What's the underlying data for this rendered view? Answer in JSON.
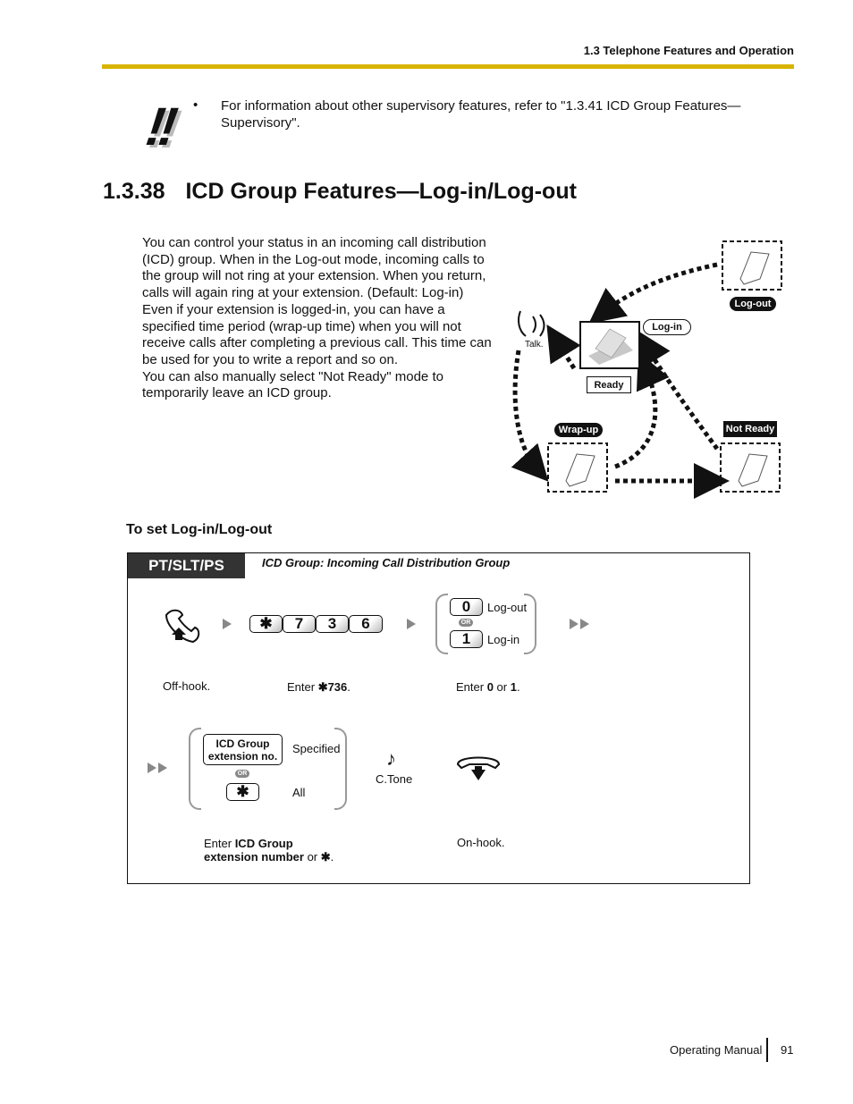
{
  "header": {
    "section_title": "1.3 Telephone Features and Operation"
  },
  "note": {
    "icon": "exclamation-note-icon",
    "bullet": "•",
    "text": "For information about other supervisory features, refer to \"1.3.41 ICD Group Features—Supervisory\"."
  },
  "section": {
    "number": "1.3.38",
    "title": "ICD Group Features—Log-in/Log-out"
  },
  "body_lines": [
    "You can control your status in an incoming call distribution",
    "(ICD) group. When in the Log-out mode, incoming calls to",
    "the group will not ring at your extension. When you return,",
    "calls will again ring at your extension. (Default: Log-in)",
    "Even if your extension is logged-in, you can have a",
    "specified time period (wrap-up time) when you will not",
    "receive calls after completing a previous call. This time can",
    "be used for you to write a report and so on.",
    "You can also manually select \"Not Ready\" mode to",
    "temporarily leave an ICD group."
  ],
  "diagram": {
    "talk_label": "Talk.",
    "login_label": "Log-in",
    "logout_label": "Log-out",
    "ready_label": "Ready",
    "wrapup_label": "Wrap-up",
    "notready_label": "Not Ready"
  },
  "procedure": {
    "subheading": "To set Log-in/Log-out",
    "tag": "PT/SLT/PS",
    "tag_note": "ICD Group: Incoming Call Distribution Group",
    "step1": {
      "offhook_caption": "Off-hook.",
      "keys": [
        "✱",
        "7",
        "3",
        "6"
      ],
      "enter_prefix": "Enter ",
      "enter_code": "✱736",
      "enter_suffix": ".",
      "options": [
        {
          "key": "0",
          "label": "Log-out"
        },
        {
          "key": "1",
          "label": "Log-in"
        }
      ],
      "or_label": "OR",
      "choice_prefix": "Enter ",
      "choice_a": "0",
      "choice_mid": " or ",
      "choice_b": "1",
      "choice_suffix": "."
    },
    "step2": {
      "group_key_line1": "ICD Group",
      "group_key_line2": "extension no.",
      "specified_label": "Specified",
      "or_label": "OR",
      "star_key": "✱",
      "all_label": "All",
      "ctone_label": "C.Tone",
      "caption_prefix": "Enter ",
      "caption_bold1": "ICD Group",
      "caption_bold2": "extension number",
      "caption_mid": " or ",
      "caption_star": "✱",
      "caption_suffix": ".",
      "onhook_caption": "On-hook."
    }
  },
  "footer": {
    "manual": "Operating Manual",
    "page": "91"
  }
}
